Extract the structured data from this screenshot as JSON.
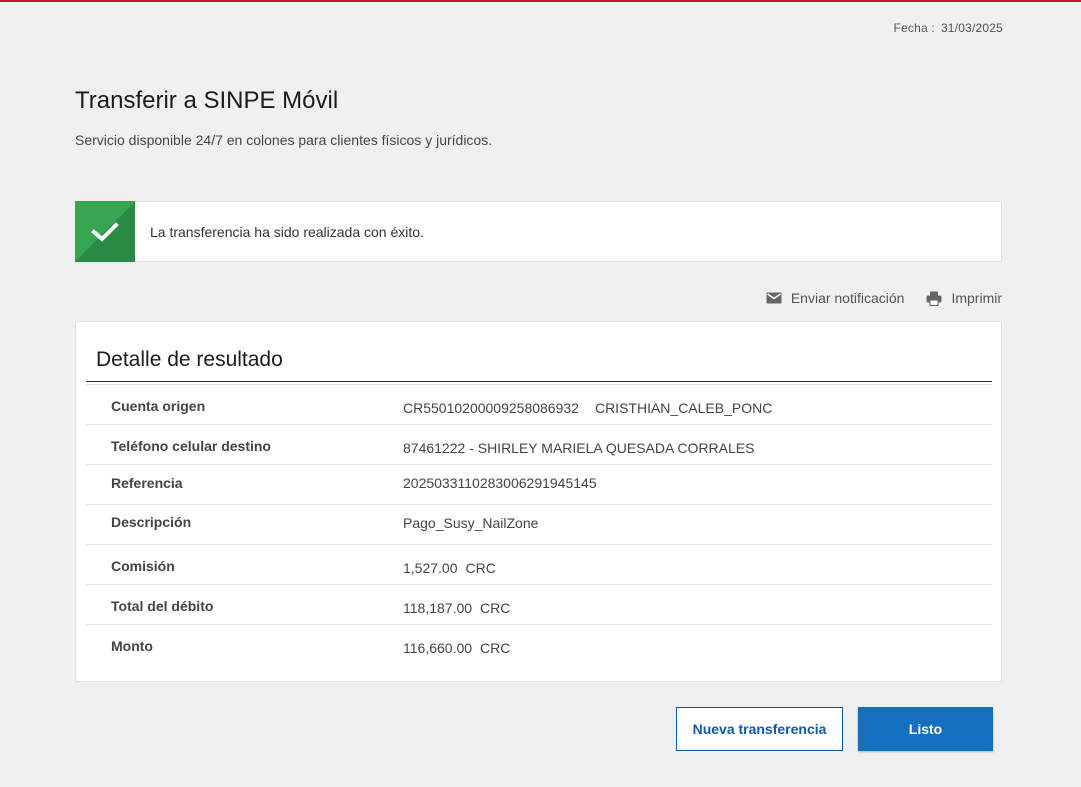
{
  "header": {
    "date_label": "Fecha :",
    "date_value": "31/03/2025"
  },
  "page": {
    "title": "Transferir a SINPE Móvil",
    "subtitle": "Servicio disponible 24/7 en colones para clientes físicos y jurídicos."
  },
  "success": {
    "icon": "checkmark-icon",
    "message": "La transferencia ha sido realizada con éxito.",
    "color": "#38a552"
  },
  "actions": {
    "notify_label": "Enviar notificación",
    "notify_icon": "mail-icon",
    "print_label": "Imprimir",
    "print_icon": "printer-icon"
  },
  "detail": {
    "title": "Detalle de resultado",
    "rows": [
      {
        "label": "Cuenta origen",
        "value": "CR55010200009258086932",
        "value2": "CRISTHIAN_CALEB_PONC"
      },
      {
        "label": "Teléfono celular destino",
        "value": "87461222 - SHIRLEY MARIELA QUESADA CORRALES",
        "value2": ""
      },
      {
        "label": "Referencia",
        "value": "2025033110283006291945145",
        "value2": ""
      },
      {
        "label": "Descripción",
        "value": "Pago_Susy_NailZone",
        "value2": ""
      },
      {
        "label": "Comisión",
        "value": "1,527.00",
        "value2": "CRC"
      },
      {
        "label": "Total del débito",
        "value": "118,187.00",
        "value2": "CRC"
      },
      {
        "label": "Monto",
        "value": "116,660.00",
        "value2": "CRC"
      }
    ]
  },
  "buttons": {
    "new_transfer": "Nueva transferencia",
    "done": "Listo",
    "primary_color": "#1470bf"
  }
}
